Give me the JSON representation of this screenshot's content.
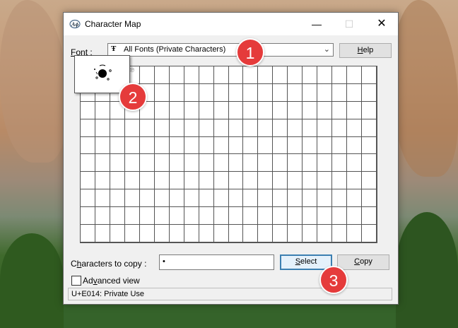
{
  "window": {
    "title": "Character Map",
    "minimize_glyph": "—",
    "maximize_glyph": "☐",
    "close_glyph": "✕",
    "icon": "charmap-app-icon"
  },
  "font_row": {
    "label": "Font :",
    "label_accesskey": "F",
    "label_rest": "ont :",
    "selected_font": "All Fonts (Private Characters)",
    "font_type_icon": "Ŧ",
    "dropdown_glyph": "⌄",
    "help_label": "Help",
    "help_accesskey": "H",
    "help_rest": "elp"
  },
  "grid": {
    "columns": 20,
    "rows": 10,
    "first_cell_glyph": "•",
    "third_cell_glyph": "℗"
  },
  "copy_row": {
    "label": "Characters to copy :",
    "label_pre": "C",
    "label_accesskey": "h",
    "label_rest": "aracters to copy :",
    "value": "•",
    "select_label": "Select",
    "select_accesskey": "S",
    "select_rest": "elect",
    "copy_label": "Copy",
    "copy_accesskey": "C",
    "copy_rest": "opy"
  },
  "advanced": {
    "label": "Advanced view",
    "label_pre": "Ad",
    "label_accesskey": "v",
    "label_rest": "anced view",
    "checked": false
  },
  "status": {
    "text": "U+E014: Private Use"
  },
  "markers": [
    "1",
    "2",
    "3"
  ],
  "colors": {
    "marker": "#e53b3b",
    "select_focus": "#3c7fb1"
  }
}
